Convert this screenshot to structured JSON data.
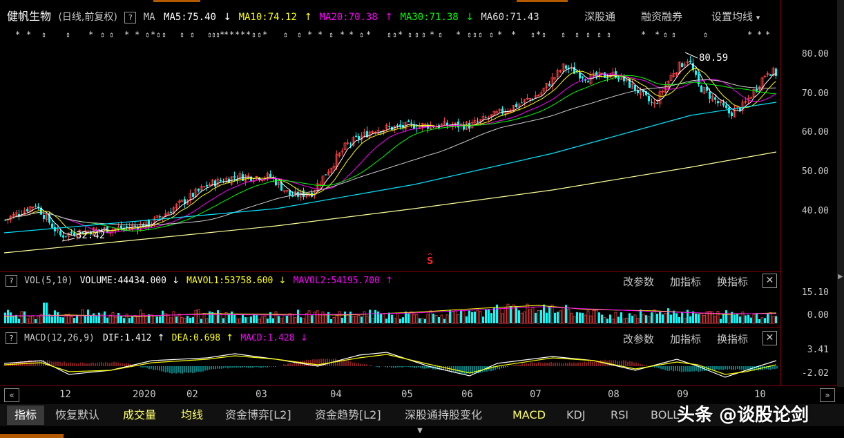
{
  "header": {
    "stock_name": "健帆生物",
    "period_info": "(日线,前复权)",
    "help": "?",
    "ma_label": "MA",
    "ma5": "MA5:75.40",
    "ma5_arrow": "↓",
    "ma10": "MA10:74.12",
    "ma10_arrow": "↑",
    "ma20": "MA20:70.38",
    "ma20_arrow": "↑",
    "ma30": "MA30:71.38",
    "ma30_arrow": "↓",
    "ma60": "MA60:71.43",
    "link_sgt": "深股通",
    "link_rzrq": "融资融券",
    "link_settings": "设置均线",
    "link_settings_caret": "▾"
  },
  "colors": {
    "ma5": "#ffffff",
    "ma10": "#ffff00",
    "ma20": "#ff00ff",
    "ma30": "#00ff00",
    "ma60": "#cccccc",
    "ma120": "#00e5ff",
    "ma250": "#ffff99",
    "up": "#ff4040",
    "down": "#00ffff",
    "separator": "#8b0000",
    "header_label": "#c8c8c8"
  },
  "price_chart": {
    "y_ticks": [
      "80.00",
      "70.00",
      "60.00",
      "50.00",
      "40.00"
    ],
    "high_label": "80.59",
    "low_label": "32.42",
    "signal_mark": "S",
    "signal_caret": "^"
  },
  "volume_panel": {
    "help": "?",
    "indicator": "VOL(5,10)",
    "volume": "VOLUME:44434.000",
    "volume_arrow": "↓",
    "mavol1": "MAVOL1:53758.600",
    "mavol1_arrow": "↓",
    "mavol2": "MAVOL2:54195.700",
    "mavol2_arrow": "↑",
    "btn_params": "改参数",
    "btn_add": "加指标",
    "btn_switch": "换指标",
    "close": "✕",
    "y_ticks": [
      "15.10",
      "0.00"
    ]
  },
  "macd_panel": {
    "help": "?",
    "indicator": "MACD(12,26,9)",
    "dif": "DIF:1.412",
    "dif_arrow": "↑",
    "dea": "DEA:0.698",
    "dea_arrow": "↑",
    "macd": "MACD:1.428",
    "macd_arrow": "↓",
    "btn_params": "改参数",
    "btn_add": "加指标",
    "btn_switch": "换指标",
    "close": "✕",
    "y_ticks": [
      "3.41",
      "-2.02"
    ]
  },
  "x_axis": {
    "labels": [
      "12",
      "2020",
      "02",
      "03",
      "04",
      "05",
      "06",
      "07",
      "08",
      "09",
      "10"
    ]
  },
  "bottom_tabs": {
    "items": [
      "指标",
      "恢复默认",
      "成交量",
      "均线",
      "资金博弈[L2]",
      "资金趋势[L2]",
      "深股通持股变化",
      "MACD",
      "KDJ",
      "RSI",
      "BOLL"
    ]
  },
  "watermark": "头条 @谈股论剑",
  "chart_data": {
    "type": "candlestick",
    "y_axis_ticks": [
      40,
      50,
      60,
      70,
      80
    ],
    "highest": 80.59,
    "lowest": 32.42,
    "months": [
      "12",
      "2020",
      "02",
      "03",
      "04",
      "05",
      "06",
      "07",
      "08",
      "09",
      "10"
    ],
    "volume_y_ticks": [
      0.0,
      15.1
    ],
    "macd_y_ticks": [
      -2.02,
      3.41
    ]
  }
}
